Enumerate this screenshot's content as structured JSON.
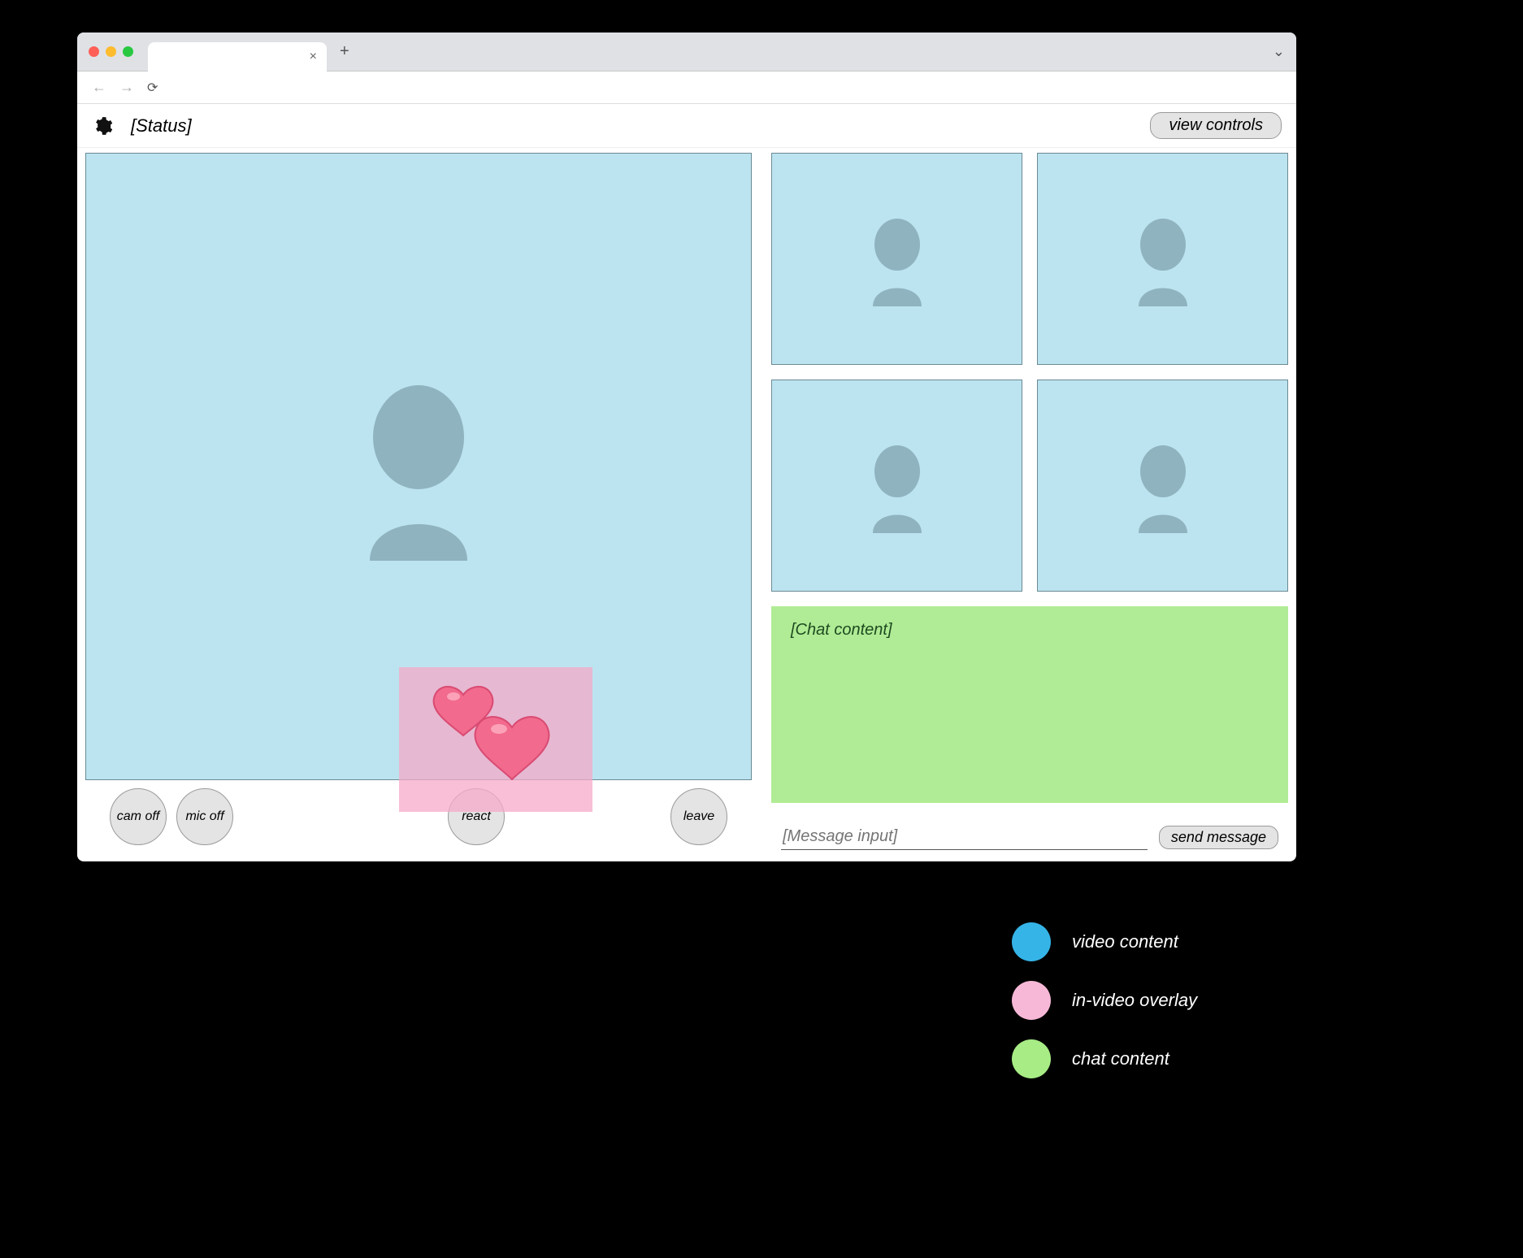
{
  "header": {
    "status_label": "[Status]",
    "view_controls_label": "view controls"
  },
  "controls": {
    "cam_label": "cam off",
    "mic_label": "mic off",
    "react_label": "react",
    "leave_label": "leave"
  },
  "reaction": {
    "emoji": "hearts-icon"
  },
  "participants": {
    "count": 4
  },
  "chat": {
    "content_placeholder": "[Chat content]",
    "input_placeholder": "[Message input]",
    "send_label": "send message"
  },
  "legend": {
    "items": [
      {
        "color": "#35b4e8",
        "label": "video content"
      },
      {
        "color": "#f7b8d7",
        "label": "in-video overlay"
      },
      {
        "color": "#a7ec85",
        "label": "chat content"
      }
    ]
  }
}
